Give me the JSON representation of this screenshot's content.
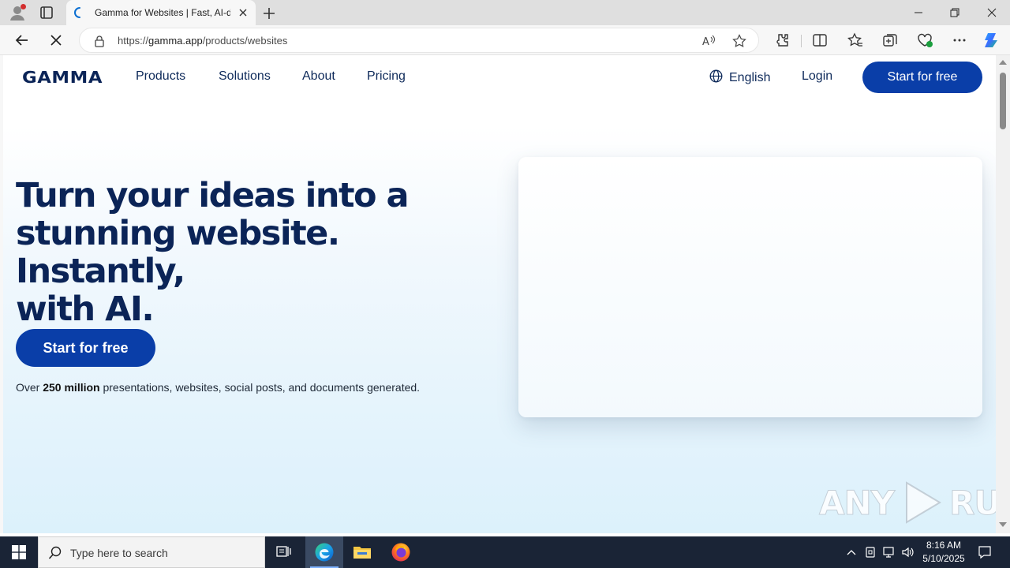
{
  "browser": {
    "tab_title": "Gamma for Websites | Fast, AI-dri",
    "url_scheme": "https://",
    "url_host": "gamma.app",
    "url_path": "/products/websites"
  },
  "site_nav": {
    "logo_text": "GAMMA",
    "links": [
      "Products",
      "Solutions",
      "About",
      "Pricing"
    ],
    "language": "English",
    "login": "Login",
    "cta": "Start for free"
  },
  "hero": {
    "title_line1": "Turn your ideas into a",
    "title_line2": "stunning website. Instantly,",
    "title_line3": "with AI.",
    "cta": "Start for free",
    "stat_prefix": "Over ",
    "stat_bold": "250 million",
    "stat_suffix": " presentations, websites, social posts, and documents generated."
  },
  "watermark": {
    "left": "ANY",
    "right": "RUN"
  },
  "taskbar": {
    "search_placeholder": "Type here to search",
    "time": "8:16 AM",
    "date": "5/10/2025"
  },
  "colors": {
    "brand_blue": "#0a3ea8",
    "heading_navy": "#0b2457",
    "taskbar": "#1a2436"
  },
  "icons": [
    "profile-icon",
    "tab-actions-icon",
    "edge-loading-icon",
    "close-icon",
    "new-tab-icon",
    "minimize-icon",
    "restore-icon",
    "window-close-icon",
    "back-icon",
    "stop-loading-icon",
    "lock-icon",
    "read-aloud-icon",
    "favorite-star-icon",
    "extensions-icon",
    "split-screen-icon",
    "favorites-icon",
    "collections-icon",
    "browser-essentials-icon",
    "more-icon",
    "copilot-icon",
    "globe-icon",
    "windows-start-icon",
    "search-icon",
    "task-view-icon",
    "edge-icon",
    "file-explorer-icon",
    "firefox-icon",
    "tray-chevron-icon",
    "network-icon",
    "volume-icon",
    "notification-icon"
  ]
}
